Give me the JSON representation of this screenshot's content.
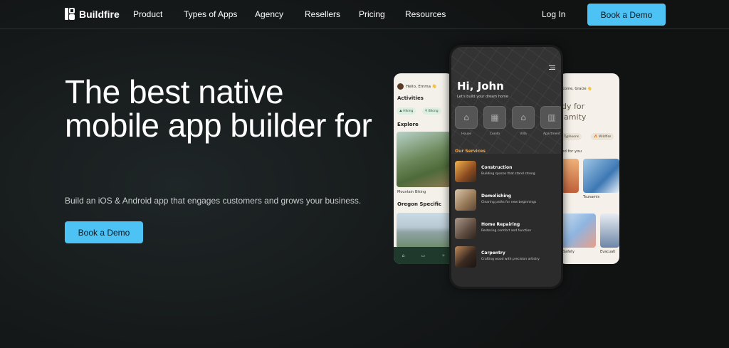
{
  "nav": {
    "brand": "Buildfire",
    "links": [
      "Product",
      "Types of Apps",
      "Agency",
      "Resellers",
      "Pricing",
      "Resources"
    ],
    "login": "Log In",
    "cta": "Book a Demo"
  },
  "hero": {
    "title": "The best native mobile app builder for",
    "subtitle": "Build an iOS & Android app that engages customers and grows your business.",
    "cta": "Book a Demo"
  },
  "phone_left": {
    "greeting": "Hello, Emma 👋",
    "activities_heading": "Activities",
    "chips": [
      "Hiking",
      "Biking"
    ],
    "explore_heading": "Explore",
    "caption1": "Mountain Biking",
    "section2": "Oregon Specific"
  },
  "phone_center": {
    "title": "Hi, John",
    "subtitle": "Let's build your dream home",
    "categories": [
      "House",
      "Condo",
      "Villa",
      "Apartment"
    ],
    "services_heading": "Our Services",
    "services": [
      {
        "title": "Construction",
        "desc": "Building spaces that stand strong"
      },
      {
        "title": "Demolishing",
        "desc": "Clearing paths for new beginnings"
      },
      {
        "title": "Home Repairing",
        "desc": "Restoring comfort and function"
      },
      {
        "title": "Carpentry",
        "desc": "Crafting wood with precision artistry"
      }
    ]
  },
  "phone_right": {
    "greeting": "lcome, Gracie 👋",
    "title_line1": "dy for",
    "title_line2": "lamity",
    "chips": [
      "f Typhoons",
      "🔥 Wildfire"
    ],
    "section": "ed for you",
    "cards": [
      "Tsunamis",
      "Safety",
      "Evacuati"
    ]
  },
  "colors": {
    "accent": "#4cc2f5",
    "services_orange": "#f4a640"
  }
}
